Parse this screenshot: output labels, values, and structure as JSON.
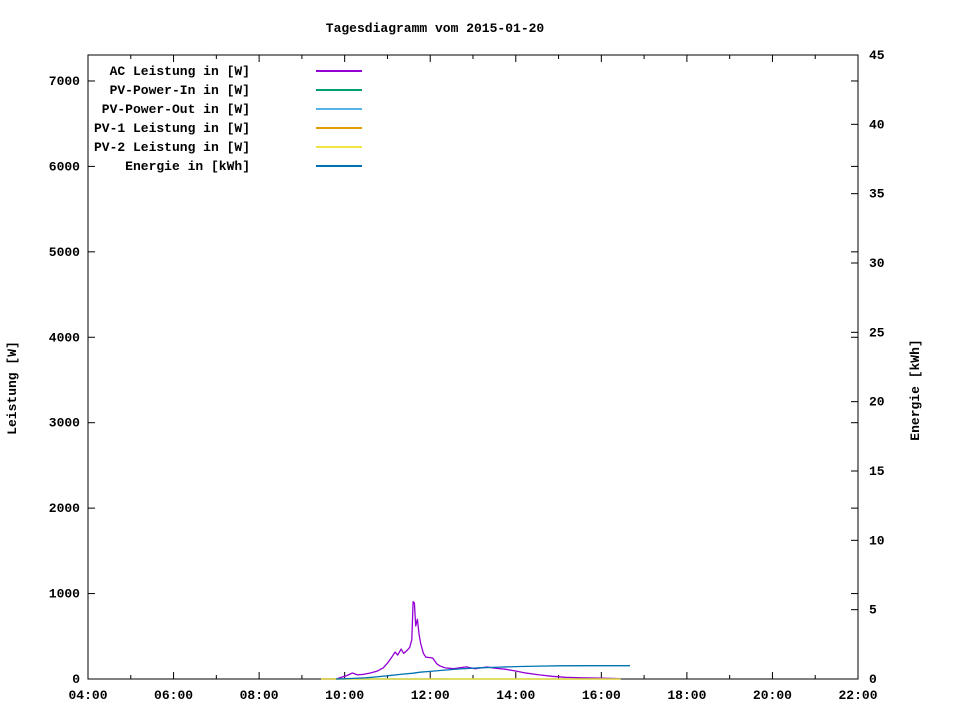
{
  "title": "Tagesdiagramm vom 2015-01-20",
  "chart_data": {
    "type": "line",
    "title": "Tagesdiagramm vom 2015-01-20",
    "grid": false,
    "legend_position": "top-left-inside",
    "background_color": "#ffffff",
    "border_color": "#000000",
    "x_axis": {
      "label": "",
      "unit": "time HH:MM",
      "range": [
        4,
        22
      ],
      "major_ticks": [
        {
          "hour": 4,
          "label": "04:00"
        },
        {
          "hour": 6,
          "label": "06:00"
        },
        {
          "hour": 8,
          "label": "08:00"
        },
        {
          "hour": 10,
          "label": "10:00"
        },
        {
          "hour": 12,
          "label": "12:00"
        },
        {
          "hour": 14,
          "label": "14:00"
        },
        {
          "hour": 16,
          "label": "16:00"
        },
        {
          "hour": 18,
          "label": "18:00"
        },
        {
          "hour": 20,
          "label": "20:00"
        },
        {
          "hour": 22,
          "label": "22:00"
        }
      ],
      "minor_tick_hours": [
        5,
        7,
        9,
        11,
        13,
        15,
        17,
        19,
        21
      ]
    },
    "y_axis_left": {
      "label": "Leistung [W]",
      "range": [
        0,
        7304
      ],
      "ticks": [
        {
          "value": 0,
          "label": "0"
        },
        {
          "value": 1000,
          "label": "1000"
        },
        {
          "value": 2000,
          "label": "2000"
        },
        {
          "value": 3000,
          "label": "3000"
        },
        {
          "value": 4000,
          "label": "4000"
        },
        {
          "value": 5000,
          "label": "5000"
        },
        {
          "value": 6000,
          "label": "6000"
        },
        {
          "value": 7000,
          "label": "7000"
        }
      ]
    },
    "y_axis_right": {
      "label": "Energie [kWh]",
      "range": [
        0,
        45
      ],
      "ticks": [
        {
          "value": 0,
          "label": "0"
        },
        {
          "value": 5,
          "label": "5"
        },
        {
          "value": 10,
          "label": "10"
        },
        {
          "value": 15,
          "label": "15"
        },
        {
          "value": 20,
          "label": "20"
        },
        {
          "value": 25,
          "label": "25"
        },
        {
          "value": 30,
          "label": "30"
        },
        {
          "value": 35,
          "label": "35"
        },
        {
          "value": 40,
          "label": "40"
        },
        {
          "value": 45,
          "label": "45"
        }
      ]
    },
    "series": [
      {
        "id": "ac-leistung",
        "name": "AC Leistung in [W]",
        "color": "#9400d3",
        "axis": "left",
        "points": [
          [
            9.45,
            0
          ],
          [
            9.8,
            0
          ],
          [
            9.95,
            25
          ],
          [
            10.05,
            40
          ],
          [
            10.18,
            70
          ],
          [
            10.3,
            48
          ],
          [
            10.45,
            55
          ],
          [
            10.6,
            70
          ],
          [
            10.75,
            90
          ],
          [
            10.9,
            130
          ],
          [
            11.0,
            185
          ],
          [
            11.1,
            255
          ],
          [
            11.18,
            315
          ],
          [
            11.24,
            280
          ],
          [
            11.32,
            350
          ],
          [
            11.38,
            300
          ],
          [
            11.45,
            330
          ],
          [
            11.52,
            370
          ],
          [
            11.57,
            460
          ],
          [
            11.6,
            905
          ],
          [
            11.63,
            890
          ],
          [
            11.66,
            620
          ],
          [
            11.7,
            700
          ],
          [
            11.74,
            520
          ],
          [
            11.78,
            410
          ],
          [
            11.84,
            300
          ],
          [
            11.9,
            255
          ],
          [
            12.0,
            250
          ],
          [
            12.06,
            245
          ],
          [
            12.15,
            180
          ],
          [
            12.22,
            155
          ],
          [
            12.35,
            130
          ],
          [
            12.55,
            120
          ],
          [
            12.84,
            142
          ],
          [
            13.05,
            120
          ],
          [
            13.33,
            140
          ],
          [
            13.5,
            128
          ],
          [
            13.75,
            115
          ],
          [
            13.98,
            95
          ],
          [
            14.2,
            72
          ],
          [
            14.55,
            48
          ],
          [
            14.85,
            32
          ],
          [
            15.15,
            20
          ],
          [
            15.5,
            14
          ],
          [
            16.0,
            9
          ],
          [
            16.45,
            4
          ]
        ]
      },
      {
        "id": "pv-power-in",
        "name": "PV-Power-In in [W]",
        "color": "#009e73",
        "axis": "left",
        "points": [
          [
            9.45,
            0
          ],
          [
            16.45,
            0
          ]
        ]
      },
      {
        "id": "pv-power-out",
        "name": "PV-Power-Out in [W]",
        "color": "#56b4e9",
        "axis": "left",
        "points": [
          [
            9.75,
            0
          ],
          [
            12.4,
            0
          ]
        ]
      },
      {
        "id": "pv1-leistung",
        "name": "PV-1 Leistung in [W]",
        "color": "#e69f00",
        "axis": "left",
        "points": [
          [
            9.45,
            0
          ],
          [
            16.45,
            0
          ]
        ]
      },
      {
        "id": "pv2-leistung",
        "name": "PV-2 Leistung in [W]",
        "color": "#f0e442",
        "axis": "left",
        "points": [
          [
            9.45,
            0
          ],
          [
            16.45,
            0
          ]
        ]
      },
      {
        "id": "energie",
        "name": "Energie in [kWh]",
        "color": "#0072b2",
        "axis": "right",
        "points": [
          [
            9.8,
            0.0
          ],
          [
            10.2,
            0.04
          ],
          [
            10.5,
            0.09
          ],
          [
            10.8,
            0.17
          ],
          [
            11.0,
            0.23
          ],
          [
            11.3,
            0.33
          ],
          [
            11.6,
            0.42
          ],
          [
            11.76,
            0.49
          ],
          [
            12.0,
            0.55
          ],
          [
            12.23,
            0.61
          ],
          [
            12.7,
            0.73
          ],
          [
            13.16,
            0.81
          ],
          [
            13.63,
            0.86
          ],
          [
            14.1,
            0.9
          ],
          [
            14.57,
            0.93
          ],
          [
            15.0,
            0.95
          ],
          [
            15.6,
            0.96
          ],
          [
            16.67,
            0.96
          ]
        ]
      }
    ]
  }
}
